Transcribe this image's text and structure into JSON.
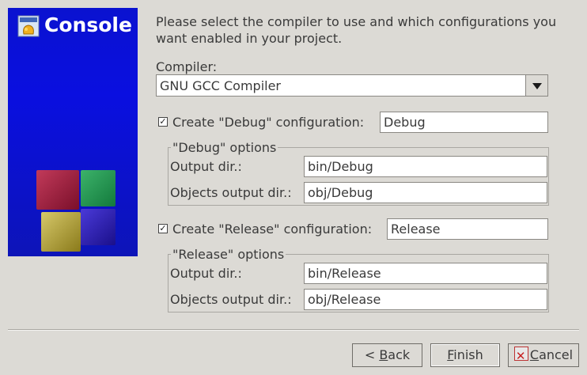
{
  "banner": {
    "title": "Console"
  },
  "intro": "Please select the compiler to use and which configurations you want enabled in your project.",
  "compiler": {
    "label": "Compiler:",
    "value": "GNU GCC Compiler"
  },
  "debug": {
    "checkbox_label": "Create \"Debug\" configuration:",
    "name_value": "Debug",
    "group_title": "\"Debug\" options",
    "output_label": "Output dir.:",
    "output_value": "bin/Debug",
    "objects_label": "Objects output dir.:",
    "objects_value": "obj/Debug"
  },
  "release": {
    "checkbox_label": "Create \"Release\" configuration:",
    "name_value": "Release",
    "group_title": "\"Release\" options",
    "output_label": "Output dir.:",
    "output_value": "bin/Release",
    "objects_label": "Objects output dir.:",
    "objects_value": "obj/Release"
  },
  "buttons": {
    "back_prefix": "< ",
    "back_mnemonic": "B",
    "back_rest": "ack",
    "finish_mnemonic": "F",
    "finish_rest": "inish",
    "cancel_mnemonic": "C",
    "cancel_rest": "ancel"
  },
  "colors": {
    "banner": "#0a12d0",
    "background": "#dcdad5"
  }
}
